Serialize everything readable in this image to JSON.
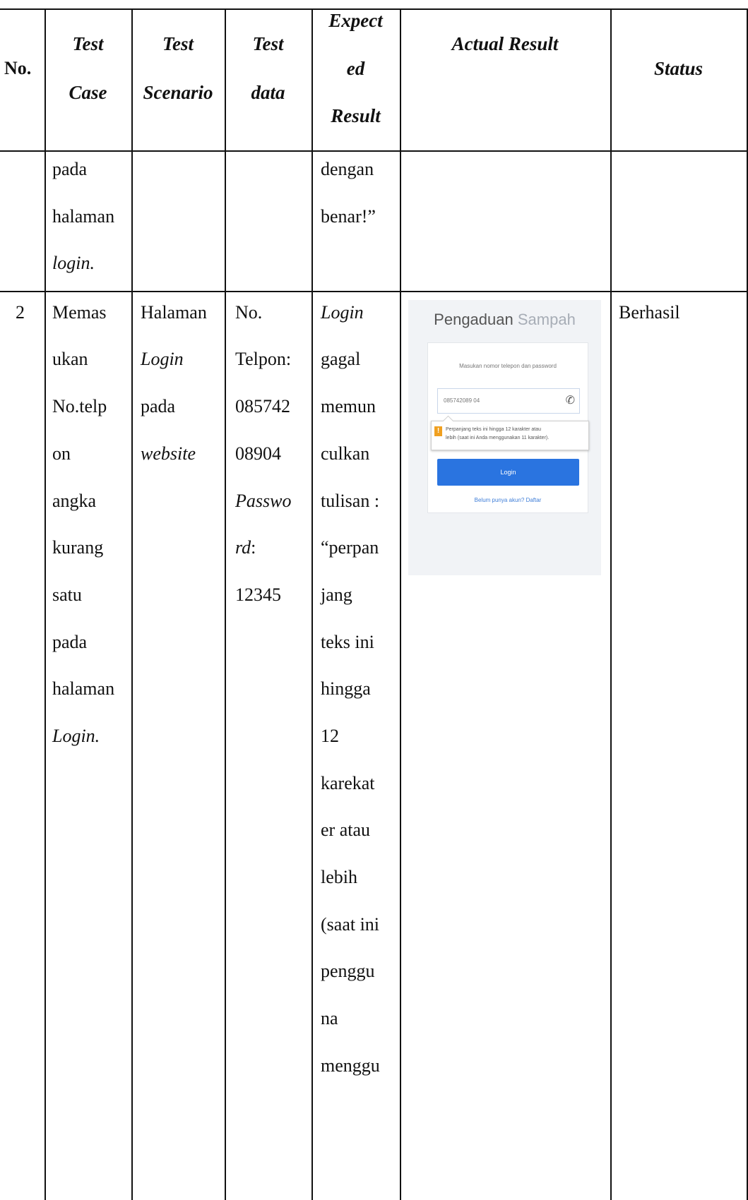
{
  "table": {
    "headers": {
      "no": "No.",
      "test_case": [
        "Test",
        "Case"
      ],
      "test_scenario": [
        "Test",
        "Scenario"
      ],
      "test_data": [
        "Test",
        "data"
      ],
      "expected_result": [
        "Expect",
        "ed",
        "Result"
      ],
      "actual_result": "Actual Result",
      "status": "Status"
    },
    "continued_row": {
      "test_case": [
        "pada",
        "halaman",
        "login."
      ],
      "expected_result": [
        "dengan",
        "benar!”"
      ]
    },
    "row2": {
      "no": "2",
      "test_case": [
        "Memas",
        "ukan",
        "No.telp",
        "on",
        "angka",
        "kurang",
        "satu",
        "pada",
        "halaman",
        "Login."
      ],
      "test_scenario": [
        "Halaman",
        "Login",
        "pada",
        "website"
      ],
      "test_data": [
        "No.",
        "Telpon:",
        "085742",
        "08904",
        "Passwo",
        "rd",
        ":",
        "12345"
      ],
      "expected_result": [
        "Login",
        "gagal",
        "memun",
        "culkan",
        "tulisan :",
        "“perpan",
        "jang",
        "teks ini",
        "hingga",
        "12",
        "karekat",
        "er atau",
        "lebih",
        "(saat ini",
        "penggu",
        "na",
        "menggu"
      ],
      "status": "Berhasil"
    }
  },
  "screenshot": {
    "title_part1": "Pengaduan",
    "title_part2": "Sampah",
    "hint": "Masukan nomor telepon dan password",
    "phone_value": "085742089 04",
    "phone_icon": "phone-icon",
    "tooltip_line1": "Perpanjang teks ini hingga 12 karakter atau",
    "tooltip_line2": "lebih (saat ini Anda menggunakan 11 karakter).",
    "tooltip_icon": "!",
    "login_label": "Login",
    "register_text": "Belum punya akun? Daftar"
  }
}
